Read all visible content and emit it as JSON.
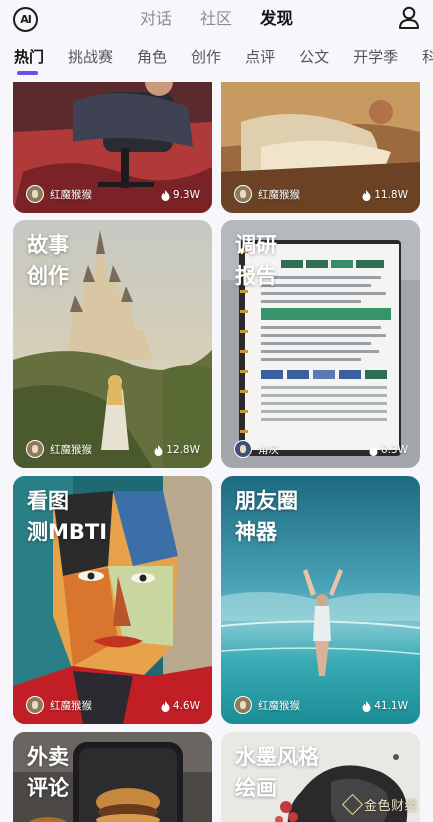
{
  "header": {
    "logo_text": "AI",
    "top_tabs": [
      {
        "label": "对话"
      },
      {
        "label": "社区"
      },
      {
        "label": "发现"
      }
    ],
    "active_top_tab": "发现"
  },
  "categories": {
    "tabs": [
      {
        "label": "热门"
      },
      {
        "label": "挑战赛"
      },
      {
        "label": "角色"
      },
      {
        "label": "创作"
      },
      {
        "label": "点评"
      },
      {
        "label": "公文"
      },
      {
        "label": "开学季"
      },
      {
        "label": "科"
      }
    ],
    "active": "热门"
  },
  "cards": [
    {
      "title": "",
      "author": "红魔猴猴",
      "likes": "9.3W"
    },
    {
      "title": "",
      "author": "红魔猴猴",
      "likes": "11.8W"
    },
    {
      "title": "故事\n创作",
      "author": "红魔猴猴",
      "likes": "12.8W"
    },
    {
      "title": "调研\n报告",
      "author": "角灰",
      "likes": "6.3W"
    },
    {
      "title": "看图\n测MBTI",
      "author": "红魔猴猴",
      "likes": "4.6W"
    },
    {
      "title": "朋友圈\n神器",
      "author": "红魔猴猴",
      "likes": "41.1W"
    },
    {
      "title": "外卖\n评论",
      "author": "",
      "likes": ""
    },
    {
      "title": "水墨风格\n绘画",
      "author": "",
      "likes": ""
    }
  ],
  "watermark": {
    "text": "金色财经"
  },
  "colors": {
    "accent": "#6c4cf1",
    "background": "#f6f6fb",
    "tab_inactive": "#8c8c96"
  }
}
